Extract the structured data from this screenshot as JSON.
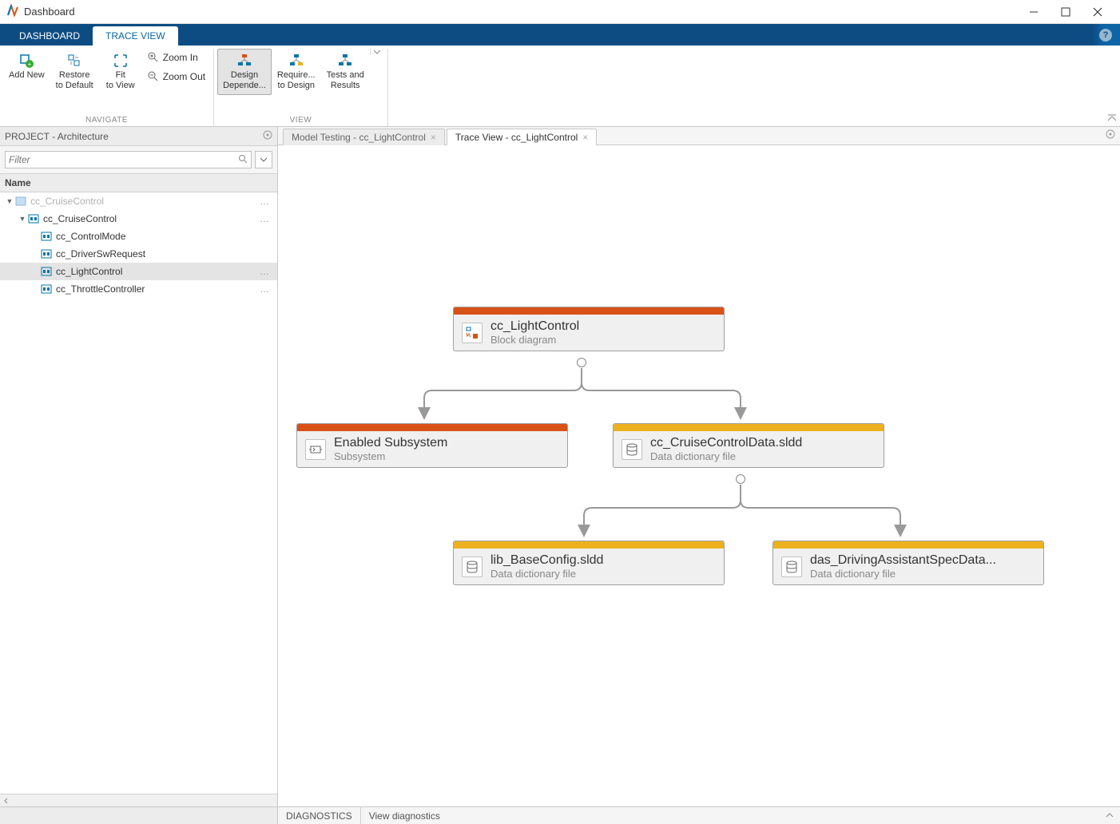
{
  "titlebar": {
    "title": "Dashboard"
  },
  "ribbon_tabs": {
    "dashboard": "DASHBOARD",
    "trace_view": "TRACE VIEW"
  },
  "toolstrip": {
    "add_new": "Add New",
    "restore": "Restore\nto Default",
    "fit": "Fit\nto View",
    "zoom_in": "Zoom In",
    "zoom_out": "Zoom Out",
    "design_dep": "Design\nDepende...",
    "require": "Require...\nto Design",
    "tests": "Tests and\nResults",
    "group_navigate": "NAVIGATE",
    "group_view": "VIEW"
  },
  "project_panel": {
    "title": "PROJECT - Architecture",
    "filter_placeholder": "Filter",
    "name_header": "Name"
  },
  "tree": {
    "root_dim": "cc_CruiseControl",
    "root": "cc_CruiseControl",
    "items": [
      "cc_ControlMode",
      "cc_DriverSwRequest",
      "cc_LightControl",
      "cc_ThrottleController"
    ]
  },
  "doc_tabs": {
    "model_testing": "Model Testing - cc_LightControl",
    "trace_view": "Trace View - cc_LightControl"
  },
  "nodes": {
    "root": {
      "title": "cc_LightControl",
      "sub": "Block diagram"
    },
    "enabled": {
      "title": "Enabled Subsystem",
      "sub": "Subsystem"
    },
    "cruise_data": {
      "title": "cc_CruiseControlData.sldd",
      "sub": "Data dictionary file"
    },
    "base_config": {
      "title": "lib_BaseConfig.sldd",
      "sub": "Data dictionary file"
    },
    "das": {
      "title": "das_DrivingAssistantSpecData...",
      "sub": "Data dictionary file"
    }
  },
  "statusbar": {
    "diagnostics": "DIAGNOSTICS",
    "view_diag": "View diagnostics"
  }
}
